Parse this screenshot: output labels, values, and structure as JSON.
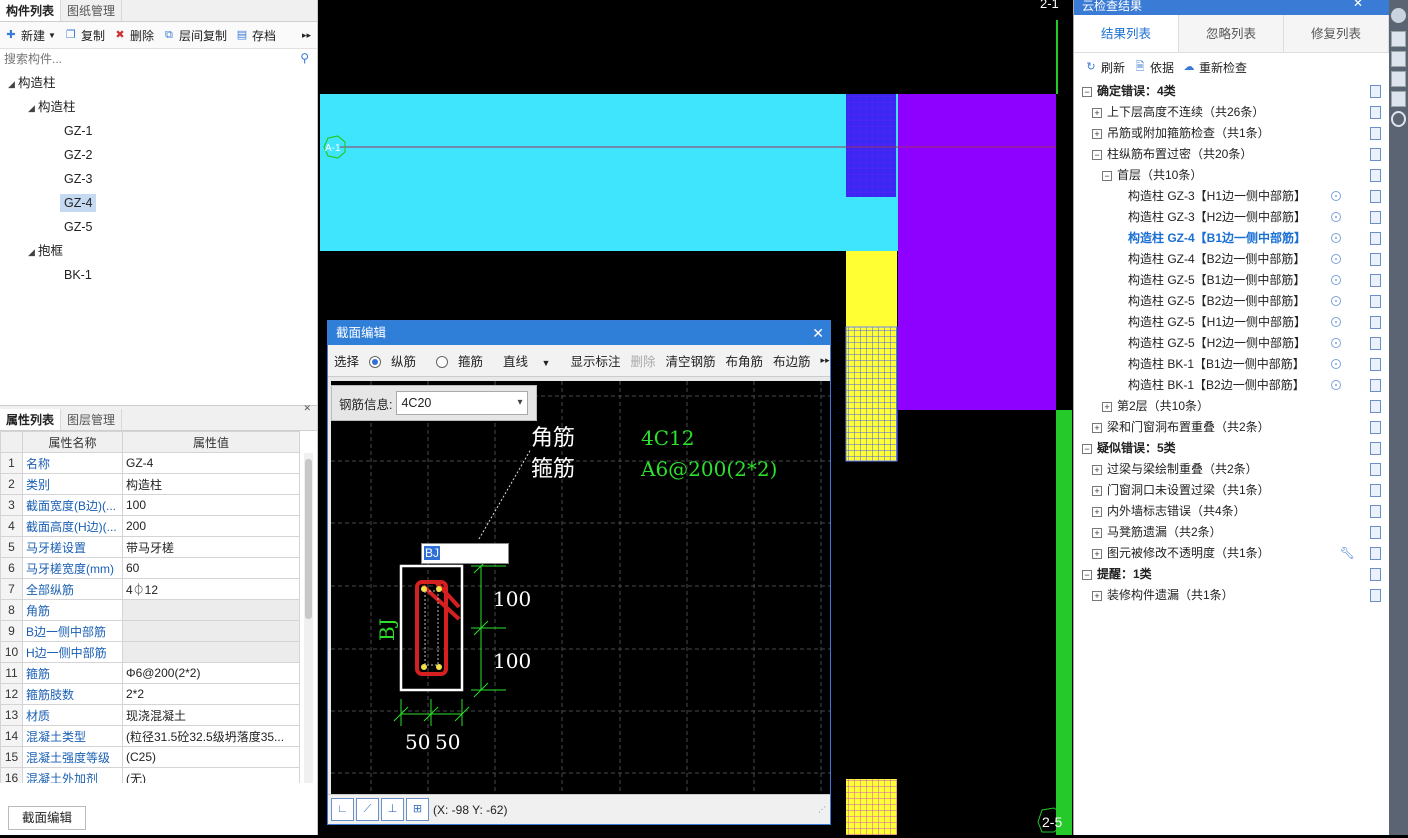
{
  "left_panel": {
    "tabs": [
      "构件列表",
      "图纸管理"
    ],
    "toolbar": [
      {
        "label": "新建",
        "icon": "new-icon"
      },
      {
        "label": "复制",
        "icon": "copy-icon"
      },
      {
        "label": "删除",
        "icon": "delete-icon"
      },
      {
        "label": "层间复制",
        "icon": "layer-copy-icon"
      },
      {
        "label": "存档",
        "icon": "archive-icon"
      }
    ],
    "search_placeholder": "搜索构件...",
    "tree": [
      {
        "label": "构造柱",
        "level": 0,
        "expanded": true
      },
      {
        "label": "构造柱",
        "level": 1,
        "expanded": true
      },
      {
        "label": "GZ-1",
        "level": 2
      },
      {
        "label": "GZ-2",
        "level": 2
      },
      {
        "label": "GZ-3",
        "level": 2
      },
      {
        "label": "GZ-4",
        "level": 2,
        "selected": true
      },
      {
        "label": "GZ-5",
        "level": 2
      },
      {
        "label": "抱框",
        "level": 1,
        "expanded": true
      },
      {
        "label": "BK-1",
        "level": 2
      }
    ],
    "prop_tabs": [
      "属性列表",
      "图层管理"
    ],
    "prop_headers": [
      "属性名称",
      "属性值"
    ],
    "properties": [
      {
        "n": "1",
        "name": "名称",
        "value": "GZ-4"
      },
      {
        "n": "2",
        "name": "类别",
        "value": "构造柱"
      },
      {
        "n": "3",
        "name": "截面宽度(B边)(...",
        "value": "100"
      },
      {
        "n": "4",
        "name": "截面高度(H边)(...",
        "value": "200"
      },
      {
        "n": "5",
        "name": "马牙槎设置",
        "value": "带马牙槎"
      },
      {
        "n": "6",
        "name": "马牙槎宽度(mm)",
        "value": "60"
      },
      {
        "n": "7",
        "name": "全部纵筋",
        "value": "4⏀12"
      },
      {
        "n": "8",
        "name": "角筋",
        "value": "",
        "gray": true
      },
      {
        "n": "9",
        "name": "B边一侧中部筋",
        "value": "",
        "gray": true
      },
      {
        "n": "10",
        "name": "H边一侧中部筋",
        "value": "",
        "gray": true
      },
      {
        "n": "11",
        "name": "箍筋",
        "value": "Φ6@200(2*2)"
      },
      {
        "n": "12",
        "name": "箍筋肢数",
        "value": "2*2"
      },
      {
        "n": "13",
        "name": "材质",
        "value": "现浇混凝土"
      },
      {
        "n": "14",
        "name": "混凝土类型",
        "value": "(粒径31.5砼32.5级坍落度35..."
      },
      {
        "n": "15",
        "name": "混凝土强度等级",
        "value": "(C25)"
      },
      {
        "n": "16",
        "name": "混凝土外加剂",
        "value": "(无)"
      }
    ],
    "bottom_tab": "截面编辑"
  },
  "canvas": {
    "axis_top": "2-1",
    "axis_bottom": "2-5",
    "axis_left": "A-1"
  },
  "dialog": {
    "title": "截面编辑",
    "tools": [
      "选择",
      "纵筋",
      "箍筋",
      "直线",
      "显示标注",
      "删除",
      "清空钢筋",
      "布角筋",
      "布边筋"
    ],
    "rebar_info_label": "钢筋信息:",
    "rebar_info_value": "4C20",
    "label_corner": "角筋",
    "label_stirrup": "箍筋",
    "value_corner": "4C12",
    "value_stirrup": "A6@200(2*2)",
    "input_value": "BJ",
    "side_label": "BJ",
    "dim_100a": "100",
    "dim_100b": "100",
    "dim_50a": "50",
    "dim_50b": "50",
    "coords": "(X: -98 Y: -62)"
  },
  "right_panel": {
    "title": "云检查结果",
    "tabs": [
      "结果列表",
      "忽略列表",
      "修复列表"
    ],
    "toolbar": [
      {
        "label": "刷新",
        "icon": "refresh-icon"
      },
      {
        "label": "依据",
        "icon": "basis-icon"
      },
      {
        "label": "重新检查",
        "icon": "cloud-check-icon"
      }
    ],
    "rows": [
      {
        "text": "确定错误：4类",
        "indent": 0,
        "pm": "−",
        "bold": true
      },
      {
        "text": "上下层高度不连续（共26条）",
        "indent": 1,
        "pm": "+"
      },
      {
        "text": "吊筋或附加箍筋检查（共1条）",
        "indent": 1,
        "pm": "+"
      },
      {
        "text": "柱纵筋布置过密（共20条）",
        "indent": 1,
        "pm": "−"
      },
      {
        "text": "首层（共10条）",
        "indent": 2,
        "pm": "−"
      },
      {
        "text": "构造柱 GZ-3【H1边一侧中部筋】",
        "indent": 3,
        "loc": true
      },
      {
        "text": "构造柱 GZ-3【H2边一侧中部筋】",
        "indent": 3,
        "loc": true
      },
      {
        "text": "构造柱 GZ-4【B1边一侧中部筋】",
        "indent": 3,
        "loc": true,
        "active": true
      },
      {
        "text": "构造柱 GZ-4【B2边一侧中部筋】",
        "indent": 3,
        "loc": true
      },
      {
        "text": "构造柱 GZ-5【B1边一侧中部筋】",
        "indent": 3,
        "loc": true
      },
      {
        "text": "构造柱 GZ-5【B2边一侧中部筋】",
        "indent": 3,
        "loc": true
      },
      {
        "text": "构造柱 GZ-5【H1边一侧中部筋】",
        "indent": 3,
        "loc": true
      },
      {
        "text": "构造柱 GZ-5【H2边一侧中部筋】",
        "indent": 3,
        "loc": true
      },
      {
        "text": "构造柱 BK-1【B1边一侧中部筋】",
        "indent": 3,
        "loc": true
      },
      {
        "text": "构造柱 BK-1【B2边一侧中部筋】",
        "indent": 3,
        "loc": true
      },
      {
        "text": "第2层（共10条）",
        "indent": 2,
        "pm": "+"
      },
      {
        "text": "梁和门窗洞布置重叠（共2条）",
        "indent": 1,
        "pm": "+"
      },
      {
        "text": "疑似错误：5类",
        "indent": 0,
        "pm": "−",
        "bold": true
      },
      {
        "text": "过梁与梁绘制重叠（共2条）",
        "indent": 1,
        "pm": "+"
      },
      {
        "text": "门窗洞口未设置过梁（共1条）",
        "indent": 1,
        "pm": "+"
      },
      {
        "text": "内外墙标志错误（共4条）",
        "indent": 1,
        "pm": "+"
      },
      {
        "text": "马凳筋遗漏（共2条）",
        "indent": 1,
        "pm": "+"
      },
      {
        "text": "图元被修改不透明度（共1条）",
        "indent": 1,
        "pm": "+",
        "wrench": true
      },
      {
        "text": "提醒：1类",
        "indent": 0,
        "pm": "−",
        "bold": true
      },
      {
        "text": "装修构件遗漏（共1条）",
        "indent": 1,
        "pm": "+"
      }
    ]
  },
  "colors": {
    "cyan": "#3ee5fd",
    "purple": "#8e00ff",
    "yellow": "#ffff33",
    "green": "#26c92a",
    "accent": "#2f7ed8",
    "rebar": "#d42020"
  }
}
